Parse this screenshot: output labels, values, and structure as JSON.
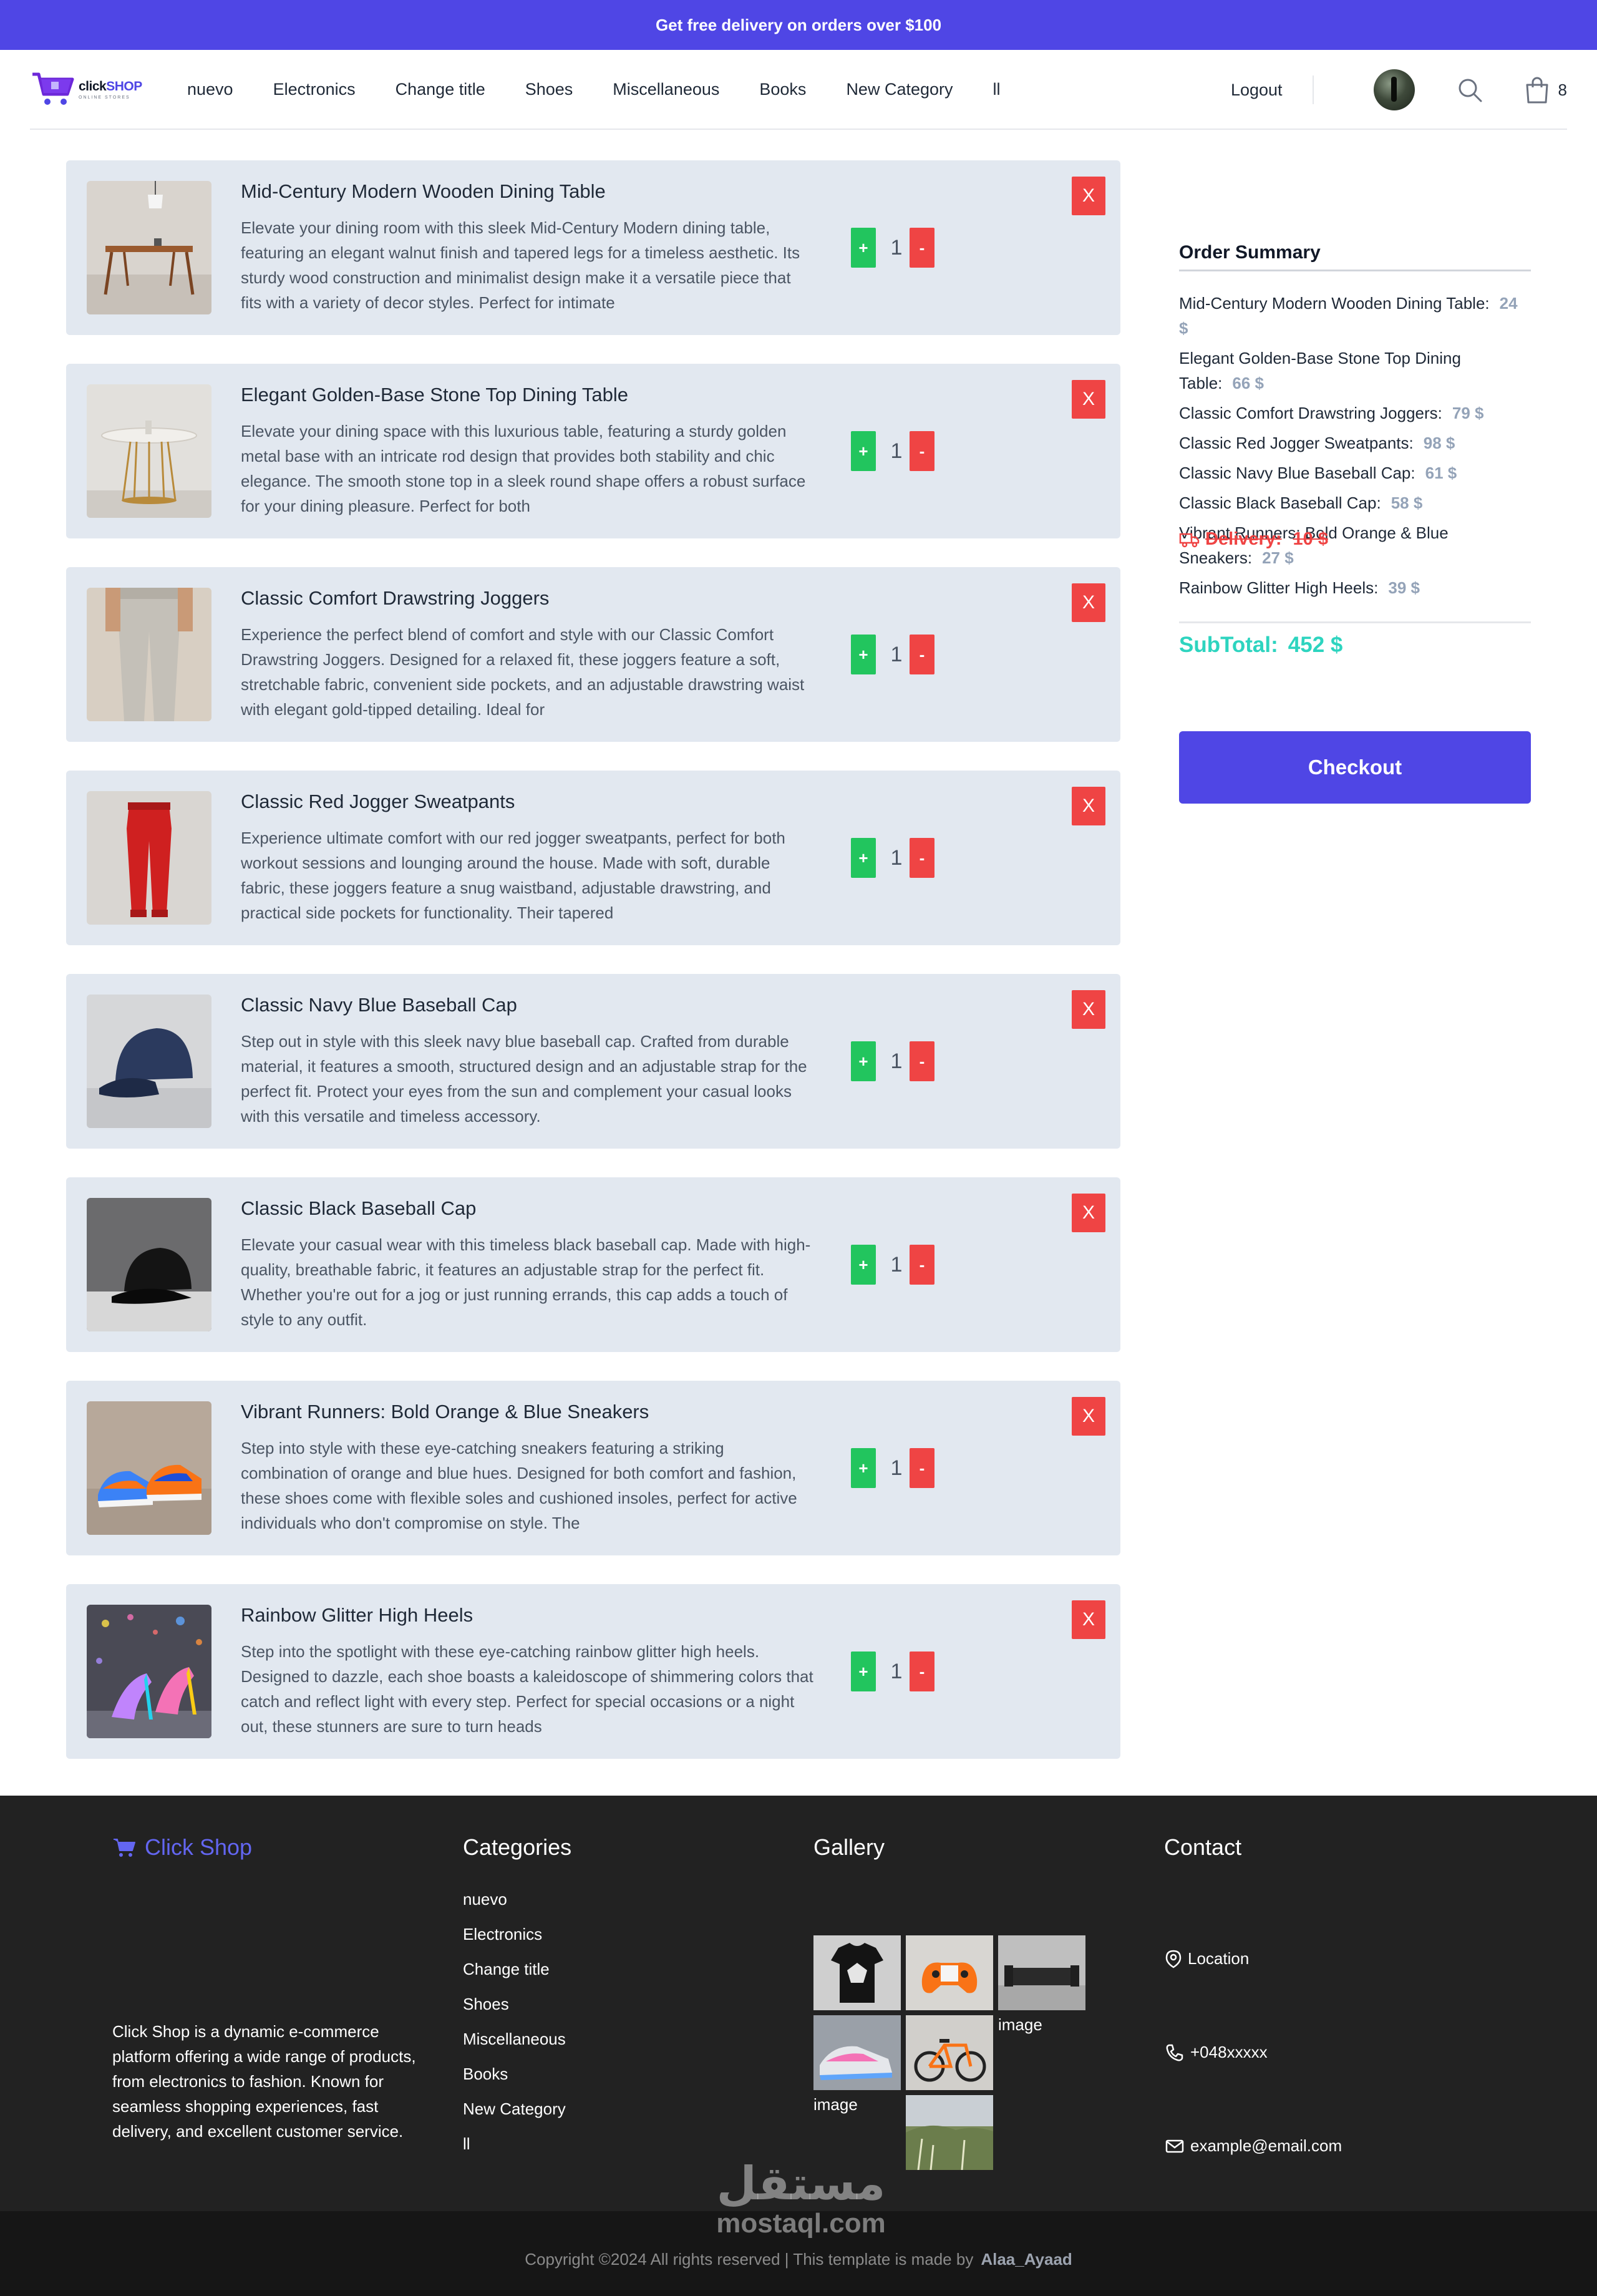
{
  "promo": {
    "text": "Get free delivery on orders over $100"
  },
  "brand": {
    "logo_main": "click",
    "logo_shop": "SHOP",
    "logo_sub": "ONLINE STORES"
  },
  "nav": {
    "items": [
      "nuevo",
      "Electronics",
      "Change title",
      "Shoes",
      "Miscellaneous",
      "Books",
      "New Category",
      "ll"
    ],
    "logout": "Logout",
    "cart_count": "8"
  },
  "cart": {
    "items": [
      {
        "title": "Mid-Century Modern Wooden Dining Table",
        "description": "Elevate your dining room with this sleek Mid-Century Modern dining table, featuring an elegant walnut finish and tapered legs for a timeless aesthetic. Its sturdy wood construction and minimalist design make it a versatile piece that fits with a variety of decor styles. Perfect for intimate",
        "qty": "1",
        "plus": "+",
        "minus": "-",
        "remove": "X"
      },
      {
        "title": "Elegant Golden-Base Stone Top Dining Table",
        "description": "Elevate your dining space with this luxurious table, featuring a sturdy golden metal base with an intricate rod design that provides both stability and chic elegance. The smooth stone top in a sleek round shape offers a robust surface for your dining pleasure. Perfect for both",
        "qty": "1",
        "plus": "+",
        "minus": "-",
        "remove": "X"
      },
      {
        "title": "Classic Comfort Drawstring Joggers",
        "description": "Experience the perfect blend of comfort and style with our Classic Comfort Drawstring Joggers. Designed for a relaxed fit, these joggers feature a soft, stretchable fabric, convenient side pockets, and an adjustable drawstring waist with elegant gold-tipped detailing. Ideal for",
        "qty": "1",
        "plus": "+",
        "minus": "-",
        "remove": "X"
      },
      {
        "title": "Classic Red Jogger Sweatpants",
        "description": "Experience ultimate comfort with our red jogger sweatpants, perfect for both workout sessions and lounging around the house. Made with soft, durable fabric, these joggers feature a snug waistband, adjustable drawstring, and practical side pockets for functionality. Their tapered",
        "qty": "1",
        "plus": "+",
        "minus": "-",
        "remove": "X"
      },
      {
        "title": "Classic Navy Blue Baseball Cap",
        "description": "Step out in style with this sleek navy blue baseball cap. Crafted from durable material, it features a smooth, structured design and an adjustable strap for the perfect fit. Protect your eyes from the sun and complement your casual looks with this versatile and timeless accessory.",
        "qty": "1",
        "plus": "+",
        "minus": "-",
        "remove": "X"
      },
      {
        "title": "Classic Black Baseball Cap",
        "description": "Elevate your casual wear with this timeless black baseball cap. Made with high-quality, breathable fabric, it features an adjustable strap for the perfect fit. Whether you're out for a jog or just running errands, this cap adds a touch of style to any outfit.",
        "qty": "1",
        "plus": "+",
        "minus": "-",
        "remove": "X"
      },
      {
        "title": "Vibrant Runners: Bold Orange & Blue Sneakers",
        "description": "Step into style with these eye-catching sneakers featuring a striking combination of orange and blue hues. Designed for both comfort and fashion, these shoes come with flexible soles and cushioned insoles, perfect for active individuals who don't compromise on style. The",
        "qty": "1",
        "plus": "+",
        "minus": "-",
        "remove": "X"
      },
      {
        "title": "Rainbow Glitter High Heels",
        "description": "Step into the spotlight with these eye-catching rainbow glitter high heels. Designed to dazzle, each shoe boasts a kaleidoscope of shimmering colors that catch and reflect light with every step. Perfect for special occasions or a night out, these stunners are sure to turn heads",
        "qty": "1",
        "plus": "+",
        "minus": "-",
        "remove": "X"
      }
    ]
  },
  "summary": {
    "title": "Order Summary",
    "lines": [
      {
        "name": "Mid-Century Modern Wooden Dining Table:",
        "price": "24 $"
      },
      {
        "name": "Elegant Golden-Base Stone Top Dining Table:",
        "price": "66 $"
      },
      {
        "name": "Classic Comfort Drawstring Joggers:",
        "price": "79 $"
      },
      {
        "name": "Classic Red Jogger Sweatpants:",
        "price": "98 $"
      },
      {
        "name": "Classic Navy Blue Baseball Cap:",
        "price": "61 $"
      },
      {
        "name": "Classic Black Baseball Cap:",
        "price": "58 $"
      },
      {
        "name": "Vibrant Runners: Bold Orange & Blue Sneakers:",
        "price": "27 $"
      },
      {
        "name": "Rainbow Glitter High Heels:",
        "price": "39 $"
      }
    ],
    "delivery_label": "Delivery:",
    "delivery_price": "10 $",
    "subtotal_label": "SubTotal:",
    "subtotal_value": "452 $",
    "checkout": "Checkout"
  },
  "footer": {
    "brand": "Click Shop",
    "about": "Click Shop is a dynamic e-commerce platform offering a wide range of products, from electronics to fashion. Known for seamless shopping experiences, fast delivery, and excellent customer service.",
    "categories_heading": "Categories",
    "categories": [
      "nuevo",
      "Electronics",
      "Change title",
      "Shoes",
      "Miscellaneous",
      "Books",
      "New Category",
      "ll"
    ],
    "gallery_heading": "Gallery",
    "gallery_broken_alt": "image",
    "contact_heading": "Contact",
    "location": "Location",
    "phone": "+048xxxxx",
    "email": "example@email.com",
    "copyright": "Copyright ©2024 All rights reserved | This template is made by",
    "author": "Alaa_Ayaad"
  },
  "watermark": {
    "arabic": "مستقل",
    "latin": "mostaql.com"
  },
  "colors": {
    "accent": "#4f46e5",
    "plus": "#22c55e",
    "minus": "#ef4444",
    "card": "#e2e8f0",
    "subtotal": "#2dd4bf",
    "footer": "#222222"
  }
}
